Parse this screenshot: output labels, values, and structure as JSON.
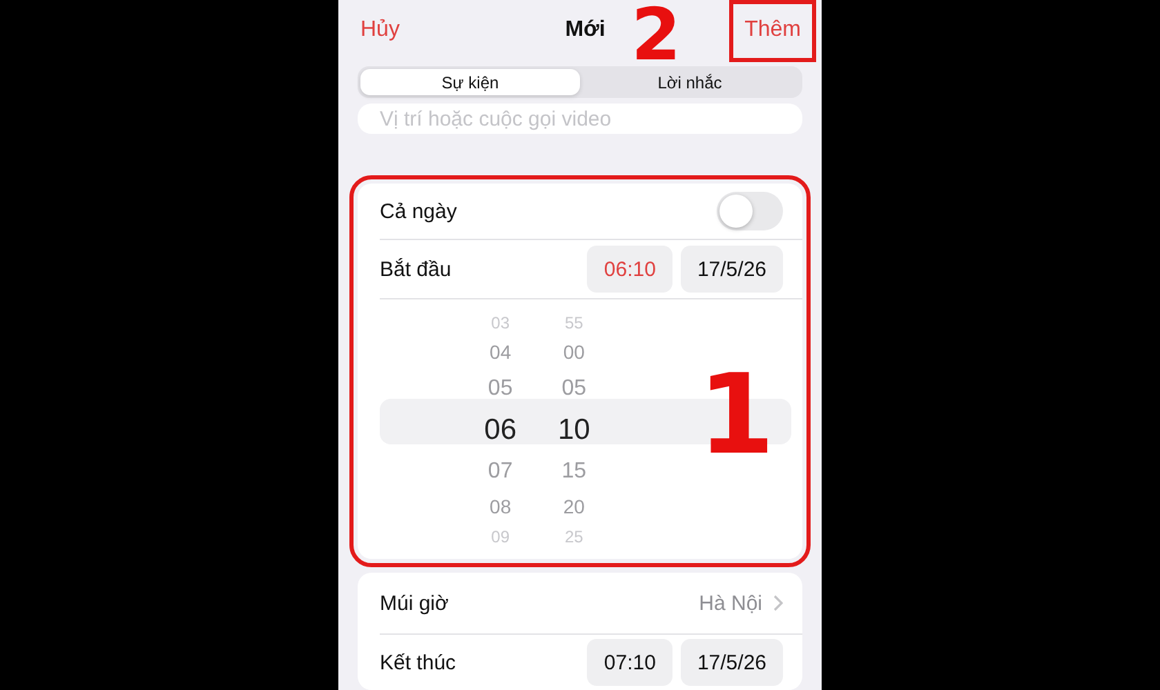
{
  "nav": {
    "cancel": "Hủy",
    "title": "Mới",
    "add": {
      "label": "Thêm",
      "highlighted": true
    }
  },
  "segments": [
    {
      "label": "Sự kiện",
      "selected": true
    },
    {
      "label": "Lời nhắc",
      "selected": false
    }
  ],
  "location": {
    "placeholder": "Vị trí hoặc cuộc gọi video"
  },
  "date_card": {
    "highlighted": true,
    "all_day": {
      "label": "Cả ngày",
      "on": false
    },
    "start": {
      "label": "Bắt đầu",
      "time": {
        "value": "06:10",
        "selected": true
      },
      "date": {
        "value": "17/5/26",
        "selected": false
      }
    },
    "picker": [
      {
        "items": [
          {
            "value": "03",
            "selected": false
          },
          {
            "value": "04",
            "selected": false
          },
          {
            "value": "05",
            "selected": false
          },
          {
            "value": "06",
            "selected": true
          },
          {
            "value": "07",
            "selected": false
          },
          {
            "value": "08",
            "selected": false
          },
          {
            "value": "09",
            "selected": false
          }
        ]
      },
      {
        "items": [
          {
            "value": "55",
            "selected": false
          },
          {
            "value": "00",
            "selected": false
          },
          {
            "value": "05",
            "selected": false
          },
          {
            "value": "10",
            "selected": true
          },
          {
            "value": "15",
            "selected": false
          },
          {
            "value": "20",
            "selected": false
          },
          {
            "value": "25",
            "selected": false
          }
        ]
      }
    ]
  },
  "timezone": {
    "label": "Múi giờ",
    "value": "Hà Nội"
  },
  "end": {
    "label": "Kết thúc",
    "time": {
      "value": "07:10",
      "selected": false
    },
    "date": {
      "value": "17/5/26",
      "selected": false
    }
  },
  "annotations": [
    {
      "label": "1"
    },
    {
      "label": "2"
    }
  ]
}
